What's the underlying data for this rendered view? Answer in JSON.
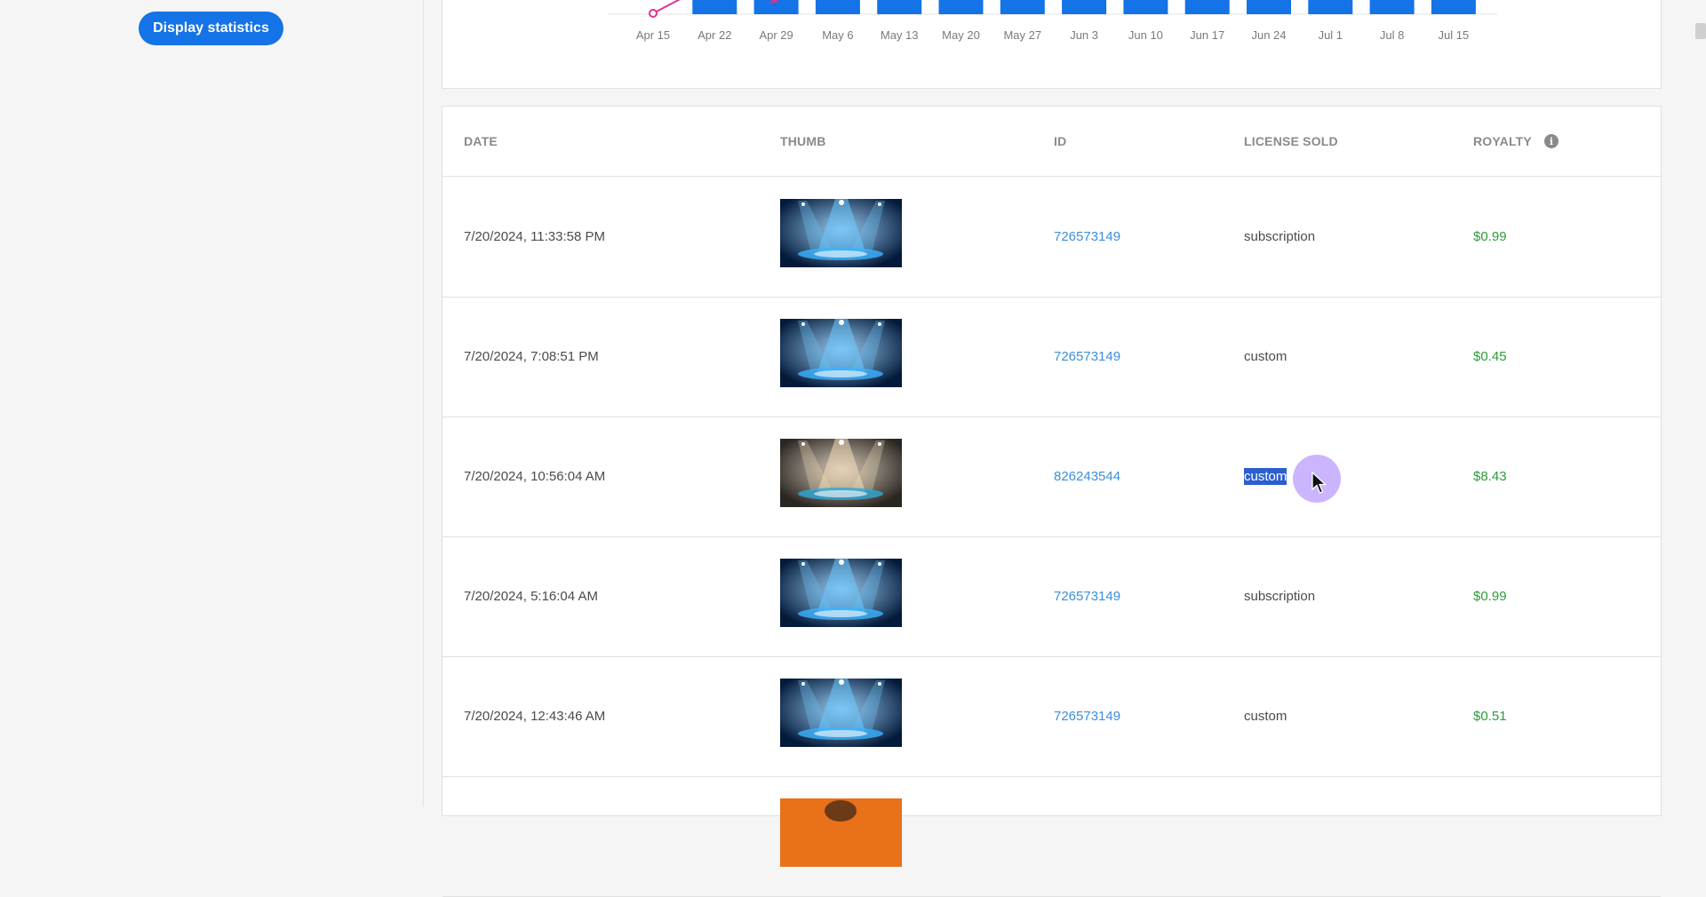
{
  "sidebar": {
    "display_statistics_label": "Display statistics"
  },
  "chart_data": {
    "type": "bar",
    "categories": [
      "Apr 15",
      "Apr 22",
      "Apr 29",
      "May 6",
      "May 13",
      "May 20",
      "May 27",
      "Jun 3",
      "Jun 10",
      "Jun 17",
      "Jun 24",
      "Jul 1",
      "Jul 8",
      "Jul 15"
    ],
    "bar_color": "#1473e6",
    "line_color": "#e0338a",
    "title": "",
    "xlabel": "",
    "ylabel": ""
  },
  "table": {
    "headers": {
      "date": "DATE",
      "thumb": "THUMB",
      "id": "ID",
      "license": "LICENSE SOLD",
      "royalty": "ROYALTY"
    },
    "info_icon": "info-icon",
    "rows": [
      {
        "date": "7/20/2024, 11:33:58 PM",
        "thumb": "stage-spotlights-blue",
        "id": "726573149",
        "license": "subscription",
        "royalty": "$0.99"
      },
      {
        "date": "7/20/2024, 7:08:51 PM",
        "thumb": "stage-spotlights-blue",
        "id": "726573149",
        "license": "custom",
        "royalty": "$0.45"
      },
      {
        "date": "7/20/2024, 10:56:04 AM",
        "thumb": "stage-spotlights-warm",
        "id": "826243544",
        "license": "custom",
        "royalty": "$8.43"
      },
      {
        "date": "7/20/2024, 5:16:04 AM",
        "thumb": "stage-spotlights-blue",
        "id": "726573149",
        "license": "subscription",
        "royalty": "$0.99"
      },
      {
        "date": "7/20/2024, 12:43:46 AM",
        "thumb": "stage-spotlights-blue",
        "id": "726573149",
        "license": "custom",
        "royalty": "$0.51"
      },
      {
        "date": "",
        "thumb": "orange-partial",
        "id": "",
        "license": "",
        "royalty": ""
      }
    ]
  },
  "colors": {
    "accent": "#1473e6",
    "link": "#3d8fdb",
    "royalty": "#2d9d3a",
    "selection": "#2b5ecf"
  }
}
